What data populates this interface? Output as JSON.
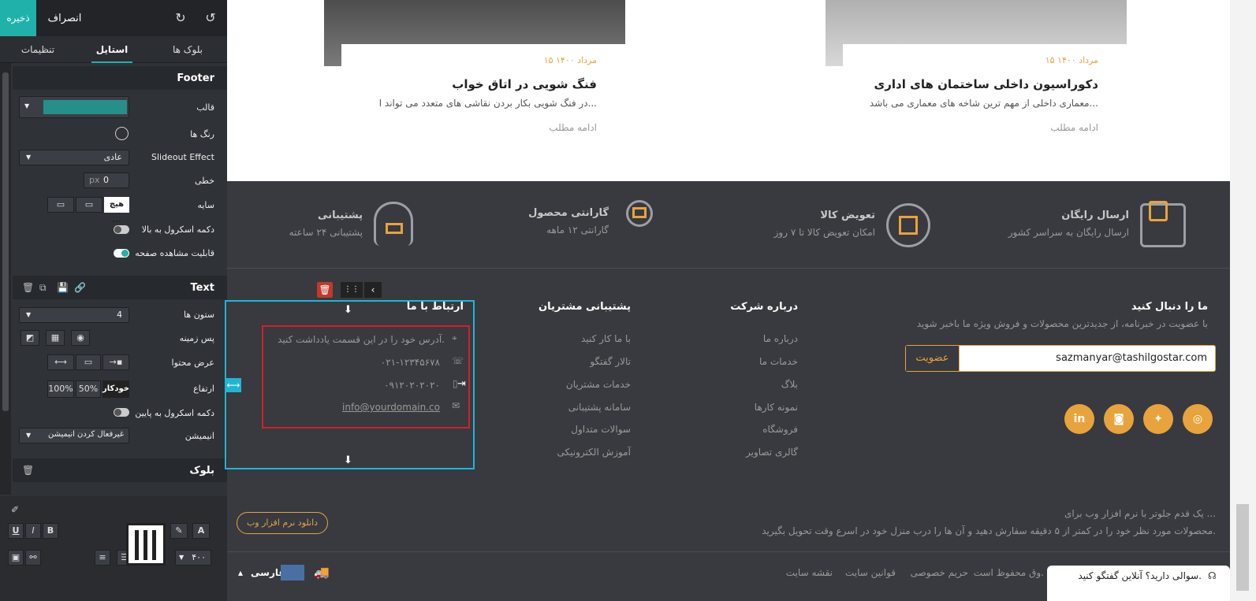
{
  "toolbar": {
    "save": "ذخیره",
    "discard": "انصراف",
    "undo_icon": "undo-icon",
    "redo_icon": "redo-icon"
  },
  "tabs": [
    "بلوک ها",
    "استایل",
    "تنظیمات"
  ],
  "footer_section": {
    "title": "Footer",
    "template_label": "قالب",
    "colors_label": "رنگ ها",
    "slideout_label": "Slideout Effect",
    "slideout_value": "عادی",
    "border_label": "خطی",
    "border_value": "0",
    "border_unit": "px",
    "shadow_label": "سایه",
    "shadow_value": "هیچ ...",
    "scroll_top_label": "دکمه اسکرول به بالا",
    "page_view_label": "قابلیت مشاهده صفحه"
  },
  "text_section": {
    "title": "Text",
    "columns_label": "ستون ها",
    "columns_value": "4",
    "background_label": "پس زمینه",
    "width_label": "عرض محتوا",
    "height_label": "ارتفاع",
    "height_options": [
      "100%",
      "50%",
      "خودکار"
    ],
    "scroll_bottom_label": "دکمه اسکرول به پایین",
    "animation_label": "انیمیشن",
    "animation_value": "غیرفعال کردن انیمیشن"
  },
  "block_section": {
    "title": "بلوک"
  },
  "format_bar": {
    "size_value": "۴۰۰"
  },
  "cards": [
    {
      "date": "۱۵ مرداد ۱۴۰۰",
      "title": "فنگ شویی در اتاق خواب",
      "desc": "در فنگ شویی بکار بردن نقاشی های متعدد می تواند ا...",
      "more": "ادامه مطلب"
    },
    {
      "date": "۱۵ مرداد ۱۴۰۰",
      "title": "دکوراسیون داخلی ساختمان های اداری",
      "desc": "معماری داخلی از مهم ترین شاخه های معماری می باشد...",
      "more": "ادامه مطلب"
    }
  ],
  "features": [
    {
      "title": "ارسال رایگان",
      "sub": "ارسال رایگان به سراسر کشور",
      "icon": "truck-icon"
    },
    {
      "title": "تعویض کالا",
      "sub": "امکان تعویض کالا تا ۷ روز",
      "icon": "box-icon"
    },
    {
      "title": "گارانتی محصول",
      "sub": "گارانتی ۱۲ ماهه",
      "icon": "badge-icon"
    },
    {
      "title": "پشتیبانی",
      "sub": "پشتیبانی ۲۴ ساعته",
      "icon": "headset-icon"
    }
  ],
  "newsletter": {
    "title": "ما را دنبال کنید",
    "desc": "با عضویت در خبرنامه، از جدیدترین محصولات و فروش ویژه ما باخبر شوید",
    "email": "sazmanyar@tashilgostar.com",
    "button": "عضویت"
  },
  "social": [
    "github-icon",
    "twitter-icon",
    "instagram-icon",
    "linkedin-icon"
  ],
  "about": {
    "title": "درباره شرکت",
    "links": [
      "درباره ما",
      "خدمات ما",
      "بلاگ",
      "نمونه کارها",
      "فروشگاه",
      "گالری تصاویر"
    ]
  },
  "support": {
    "title": "پشتیبانی مشتریان",
    "links": [
      "با ما کار کنید",
      "تالار گفتگو",
      "خدمات مشتریان",
      "سامانه پشتیبانی",
      "سوالات متداول",
      "آموزش الکترونیکی"
    ]
  },
  "contact": {
    "title": "ارتباط با ما",
    "address": "آدرس خود را در این قسمت یادداشت کنید.",
    "phone": "۰۲۱-۱۲۳۴۵۶۷۸",
    "mobile": "۰۹۱۲۰۲۰۲۰۲۰",
    "email": "info@yourdomain.co"
  },
  "promo": {
    "line1": "یک قدم جلوتر با نرم افزار وب برای ...",
    "line2": "محصولات مورد نظر خود را در کمتر از ۵ دقیقه سفارش دهید و آن ها را درب منزل خود در اسرع وقت تحویل بگیرید.",
    "download": "دانلود نرم افزار وب"
  },
  "bottom": {
    "copyright": "وق محفوظ است.",
    "privacy": "حریم خصوصی",
    "rules": "قوانین سایت",
    "sitemap": "نقشه سایت",
    "language": "فارسی",
    "chat": "سوالی دارید؟ آنلاین گفتگو کنید."
  },
  "colors": {
    "accent": "#20b2aa",
    "gold": "#e8a33c",
    "footer_bg": "#383a3f"
  }
}
